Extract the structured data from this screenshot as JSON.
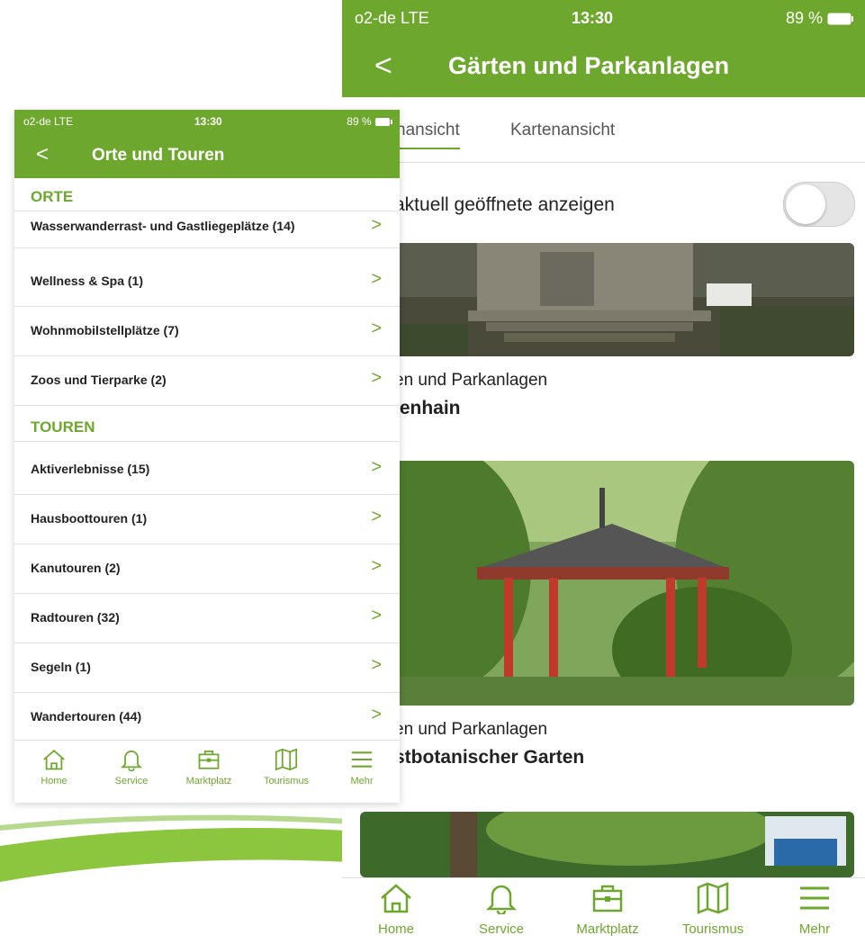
{
  "right_screen": {
    "status": {
      "carrier": "o2-de  LTE",
      "time": "13:30",
      "battery": "89 %"
    },
    "nav": {
      "back": "<",
      "title": "Gärten und Parkanlagen"
    },
    "tabs": [
      {
        "label": "nansicht"
      },
      {
        "label": "Kartenansicht"
      }
    ],
    "filter": {
      "label": "aktuell geöffnete anzeigen",
      "toggle_on": false
    },
    "cards": [
      {
        "category": "en und Parkanlagen",
        "title": "lenhain"
      },
      {
        "category": "en und Parkanlagen",
        "title": "stbotanischer Garten"
      }
    ],
    "bottom_nav": [
      {
        "icon": "home-icon",
        "label": "Home"
      },
      {
        "icon": "bell-icon",
        "label": "Service"
      },
      {
        "icon": "briefcase-icon",
        "label": "Marktplatz"
      },
      {
        "icon": "map-icon",
        "label": "Tourismus"
      },
      {
        "icon": "menu-icon",
        "label": "Mehr"
      }
    ]
  },
  "left_screen": {
    "status": {
      "carrier": "o2-de  LTE",
      "time": "13:30",
      "battery": "89 %"
    },
    "nav": {
      "back": "<",
      "title": "Orte und Touren"
    },
    "sections": [
      {
        "title": "ORTE",
        "items": [
          "Wasserwanderrast- und Gastliegeplätze (14)",
          "Wellness & Spa (1)",
          "Wohnmobilstellplätze (7)",
          "Zoos und Tierparke (2)"
        ]
      },
      {
        "title": "TOUREN",
        "items": [
          "Aktiverlebnisse (15)",
          "Hausboottouren (1)",
          "Kanutouren (2)",
          "Radtouren (32)",
          "Segeln (1)",
          "Wandertouren (44)"
        ]
      }
    ],
    "chevron": ">",
    "bottom_nav": [
      {
        "icon": "home-icon",
        "label": "Home"
      },
      {
        "icon": "bell-icon",
        "label": "Service"
      },
      {
        "icon": "briefcase-icon",
        "label": "Marktplatz"
      },
      {
        "icon": "map-icon",
        "label": "Tourismus"
      },
      {
        "icon": "menu-icon",
        "label": "Mehr"
      }
    ]
  },
  "background": {
    "glyphs": "g\n|"
  },
  "colors": {
    "brand_green": "#6ea72d",
    "text": "#222222",
    "divider": "#e2e2e2"
  }
}
